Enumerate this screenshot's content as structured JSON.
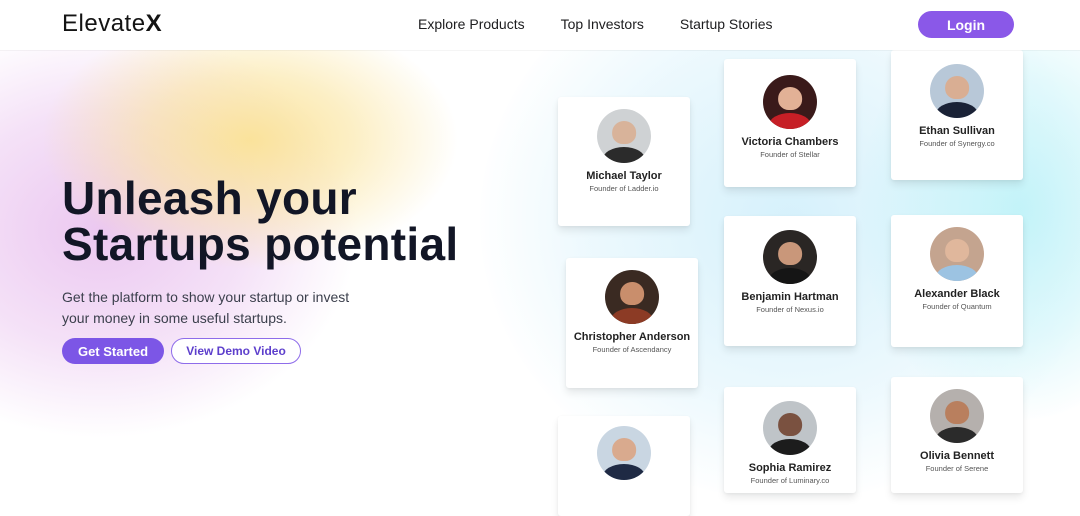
{
  "brand": {
    "name_prefix": "Elevate",
    "name_suffix": "X"
  },
  "nav": {
    "links": [
      {
        "label": "Explore Products"
      },
      {
        "label": "Top Investors"
      },
      {
        "label": "Startup Stories"
      }
    ],
    "login_label": "Login"
  },
  "hero": {
    "title_line1": "Unleash your",
    "title_line2": "Startups potential",
    "subtitle_line1": "Get the platform to show your startup or invest",
    "subtitle_line2": "your money in some useful startups.",
    "primary_cta": "Get Started",
    "secondary_cta": "View Demo Video"
  },
  "profiles": [
    {
      "name": "Michael Taylor",
      "role": "Founder of Ladder.io"
    },
    {
      "name": "Victoria Chambers",
      "role": "Founder of Stellar"
    },
    {
      "name": "Ethan Sullivan",
      "role": "Founder of Synergy.co"
    },
    {
      "name": "Christopher Anderson",
      "role": "Founder of Ascendancy"
    },
    {
      "name": "Benjamin Hartman",
      "role": "Founder of Nexus.io"
    },
    {
      "name": "Alexander Black",
      "role": "Founder of Quantum"
    },
    {
      "name": "Sophia Ramirez",
      "role": "Founder of Luminary.co"
    },
    {
      "name": "Olivia Bennett",
      "role": "Founder of Serene"
    }
  ],
  "colors": {
    "accent": "#7c56e6",
    "login": "#8a58e8",
    "text_dark": "#121626"
  }
}
